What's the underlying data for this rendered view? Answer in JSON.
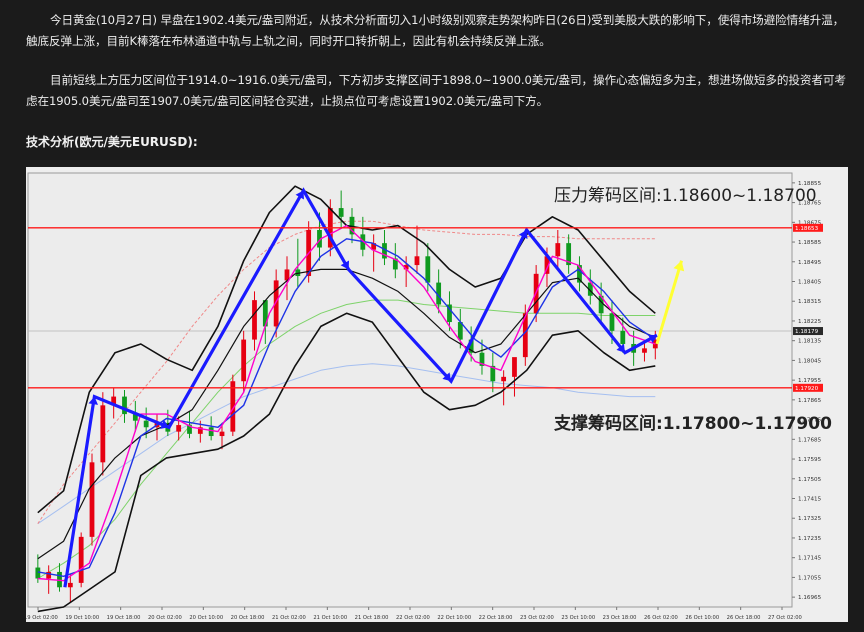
{
  "article": {
    "paragraph1": "今日黄金(10月27日) 早盘在1902.4美元/盎司附近，从技术分析面切入1小时级别观察走势架构昨日(26日)受到美股大跌的影响下，使得市场避险情绪升温，触底反弹上涨，目前K棒落在布林通道中轨与上轨之间，同时开口转折朝上，因此有机会持续反弹上涨。",
    "paragraph2": "目前短线上方压力区间位于1914.0~1916.0美元/盎司，下方初步支撑区间于1898.0~1900.0美元/盎司，操作心态偏短多为主，想进场做短多的投资者可考虑在1905.0美元/盎司至1907.0美元/盎司区间轻仓买进，止损点位可考虑设置1902.0美元/盎司下方。",
    "chart_heading": "技术分析(欧元/美元EURUSD):"
  },
  "chart_data": {
    "type": "line",
    "symbol": "EURUSD",
    "timeframe": "H1",
    "x_labels": [
      "19 Oct 02:00",
      "19 Oct 10:00",
      "19 Oct 18:00",
      "20 Oct 02:00",
      "20 Oct 10:00",
      "20 Oct 18:00",
      "21 Oct 02:00",
      "21 Oct 10:00",
      "21 Oct 18:00",
      "22 Oct 02:00",
      "22 Oct 10:00",
      "22 Oct 18:00",
      "23 Oct 02:00",
      "23 Oct 10:00",
      "23 Oct 18:00",
      "26 Oct 02:00",
      "26 Oct 10:00",
      "26 Oct 18:00",
      "27 Oct 02:00"
    ],
    "y_ticks": [
      "1.18855",
      "1.18765",
      "1.18675",
      "1.18585",
      "1.18495",
      "1.18405",
      "1.18315",
      "1.18225",
      "1.18135",
      "1.18045",
      "1.17955",
      "1.17865",
      "1.17775",
      "1.17685",
      "1.17595",
      "1.17505",
      "1.17415",
      "1.17325",
      "1.17235",
      "1.17145",
      "1.17055",
      "1.16965"
    ],
    "ylim": [
      1.1692,
      1.189
    ],
    "current_price_label": "1.18179",
    "resistance_line_label": "1.18653",
    "support_line_label": "1.17920",
    "resistance_zone_text": "压力筹码区间:1.18600~1.18700",
    "support_zone_text": "支撑筹码区间:1.17800~1.17900",
    "resistance_level": 1.1865,
    "support_level": 1.1792,
    "candles": [
      [
        1.171,
        1.1716,
        1.1703,
        1.1705
      ],
      [
        1.1705,
        1.1711,
        1.1698,
        1.1708
      ],
      [
        1.1708,
        1.1712,
        1.1699,
        1.1701
      ],
      [
        1.1701,
        1.1707,
        1.1694,
        1.1703
      ],
      [
        1.1703,
        1.1726,
        1.1701,
        1.1724
      ],
      [
        1.1724,
        1.1762,
        1.172,
        1.1758
      ],
      [
        1.1758,
        1.179,
        1.1752,
        1.1784
      ],
      [
        1.1784,
        1.1792,
        1.1778,
        1.1788
      ],
      [
        1.1788,
        1.1791,
        1.1776,
        1.178
      ],
      [
        1.178,
        1.1786,
        1.1772,
        1.1777
      ],
      [
        1.1777,
        1.1783,
        1.1769,
        1.1774
      ],
      [
        1.1774,
        1.178,
        1.1768,
        1.1776
      ],
      [
        1.1776,
        1.1782,
        1.177,
        1.1772
      ],
      [
        1.1772,
        1.1779,
        1.1768,
        1.1775
      ],
      [
        1.1775,
        1.1781,
        1.1769,
        1.1771
      ],
      [
        1.1771,
        1.1777,
        1.1767,
        1.1774
      ],
      [
        1.1774,
        1.1779,
        1.1768,
        1.177
      ],
      [
        1.177,
        1.1776,
        1.1764,
        1.1772
      ],
      [
        1.1772,
        1.1798,
        1.177,
        1.1795
      ],
      [
        1.1795,
        1.1818,
        1.179,
        1.1814
      ],
      [
        1.1814,
        1.1836,
        1.1809,
        1.1832
      ],
      [
        1.1832,
        1.1828,
        1.1812,
        1.182
      ],
      [
        1.182,
        1.1846,
        1.1815,
        1.1841
      ],
      [
        1.1841,
        1.1852,
        1.1832,
        1.1846
      ],
      [
        1.1846,
        1.186,
        1.1838,
        1.1843
      ],
      [
        1.1843,
        1.1868,
        1.184,
        1.1864
      ],
      [
        1.1864,
        1.1872,
        1.185,
        1.1856
      ],
      [
        1.1856,
        1.1878,
        1.1852,
        1.1874
      ],
      [
        1.1874,
        1.1882,
        1.1865,
        1.187
      ],
      [
        1.187,
        1.1874,
        1.1858,
        1.1862
      ],
      [
        1.1862,
        1.187,
        1.1852,
        1.1855
      ],
      [
        1.1855,
        1.1862,
        1.1845,
        1.1858
      ],
      [
        1.1858,
        1.1864,
        1.1848,
        1.1851
      ],
      [
        1.1851,
        1.1858,
        1.1842,
        1.1846
      ],
      [
        1.1846,
        1.1852,
        1.1838,
        1.1848
      ],
      [
        1.1848,
        1.1866,
        1.1844,
        1.1852
      ],
      [
        1.1852,
        1.1858,
        1.1836,
        1.184
      ],
      [
        1.184,
        1.1846,
        1.1826,
        1.183
      ],
      [
        1.183,
        1.1836,
        1.1818,
        1.1822
      ],
      [
        1.1822,
        1.1828,
        1.181,
        1.1814
      ],
      [
        1.1814,
        1.182,
        1.1804,
        1.1808
      ],
      [
        1.1808,
        1.1814,
        1.1798,
        1.1802
      ],
      [
        1.1802,
        1.1808,
        1.179,
        1.1795
      ],
      [
        1.1795,
        1.18,
        1.1784,
        1.1797
      ],
      [
        1.1797,
        1.1803,
        1.1788,
        1.1806
      ],
      [
        1.1806,
        1.183,
        1.1802,
        1.1826
      ],
      [
        1.1826,
        1.1848,
        1.1822,
        1.1844
      ],
      [
        1.1844,
        1.1856,
        1.1838,
        1.1852
      ],
      [
        1.1852,
        1.1864,
        1.1846,
        1.1858
      ],
      [
        1.1858,
        1.1862,
        1.1844,
        1.1848
      ],
      [
        1.1848,
        1.1852,
        1.1836,
        1.184
      ],
      [
        1.184,
        1.1846,
        1.183,
        1.1834
      ],
      [
        1.1834,
        1.184,
        1.1822,
        1.1826
      ],
      [
        1.1826,
        1.1832,
        1.1812,
        1.1818
      ],
      [
        1.1818,
        1.1824,
        1.1808,
        1.1812
      ],
      [
        1.1812,
        1.1818,
        1.1802,
        1.1808
      ],
      [
        1.1808,
        1.1814,
        1.1804,
        1.181
      ],
      [
        1.181,
        1.1818,
        1.1805,
        1.1814
      ]
    ],
    "bands": {
      "upper": [
        1.1735,
        1.1745,
        1.179,
        1.1808,
        1.1812,
        1.1805,
        1.18,
        1.182,
        1.185,
        1.1872,
        1.1884,
        1.1878,
        1.1866,
        1.1864,
        1.1866,
        1.1858,
        1.1846,
        1.1838,
        1.1842,
        1.1862,
        1.187,
        1.1864,
        1.185,
        1.1836,
        1.1826
      ],
      "lower": [
        1.169,
        1.1692,
        1.17,
        1.1708,
        1.1752,
        1.176,
        1.1762,
        1.1764,
        1.177,
        1.178,
        1.1802,
        1.182,
        1.1826,
        1.1822,
        1.1806,
        1.179,
        1.1782,
        1.1784,
        1.179,
        1.18,
        1.1816,
        1.1818,
        1.1808,
        1.18,
        1.1802
      ],
      "middle": [
        1.1714,
        1.1722,
        1.1746,
        1.176,
        1.177,
        1.1775,
        1.1782,
        1.18,
        1.182,
        1.1834,
        1.1844,
        1.1846,
        1.1846,
        1.1842,
        1.1836,
        1.1826,
        1.1815,
        1.1808,
        1.1812,
        1.1826,
        1.184,
        1.1842,
        1.183,
        1.182,
        1.1815
      ]
    },
    "ma_fast": [
      1.1705,
      1.1704,
      1.1712,
      1.1744,
      1.178,
      1.178,
      1.1774,
      1.1772,
      1.179,
      1.1826,
      1.1846,
      1.186,
      1.1866,
      1.1855,
      1.185,
      1.1838,
      1.182,
      1.1804,
      1.18,
      1.1826,
      1.1852,
      1.1848,
      1.1832,
      1.1816,
      1.1812
    ],
    "ma_slow": [
      1.1708,
      1.1706,
      1.171,
      1.1735,
      1.177,
      1.1778,
      1.1776,
      1.1774,
      1.1784,
      1.1812,
      1.1836,
      1.1852,
      1.186,
      1.1858,
      1.1852,
      1.1842,
      1.1828,
      1.1814,
      1.1806,
      1.1818,
      1.1838,
      1.1846,
      1.1836,
      1.1822,
      1.1814
    ],
    "ma_long_1": [
      1.1705,
      1.1712,
      1.172,
      1.1732,
      1.1748,
      1.1762,
      1.1776,
      1.179,
      1.1802,
      1.1812,
      1.182,
      1.1826,
      1.183,
      1.1832,
      1.1832,
      1.183,
      1.1829,
      1.1828,
      1.1827,
      1.1826,
      1.1826,
      1.1826,
      1.1825,
      1.1825,
      1.1825
    ],
    "ma_long_2": [
      1.173,
      1.1748,
      1.1762,
      1.1776,
      1.179,
      1.1804,
      1.182,
      1.1834,
      1.1846,
      1.1856,
      1.1862,
      1.1866,
      1.1868,
      1.1868,
      1.1866,
      1.1864,
      1.1863,
      1.1862,
      1.1862,
      1.1861,
      1.1861,
      1.186,
      1.186,
      1.186,
      1.186
    ],
    "ma_long_3": [
      1.173,
      1.1738,
      1.1746,
      1.1754,
      1.1762,
      1.177,
      1.1776,
      1.1782,
      1.1788,
      1.1792,
      1.1796,
      1.18,
      1.1802,
      1.1803,
      1.1802,
      1.18,
      1.1798,
      1.1796,
      1.1794,
      1.1793,
      1.1792,
      1.179,
      1.1789,
      1.1788,
      1.1788
    ],
    "zigzag": [
      [
        0.045,
        1.1701
      ],
      [
        0.081,
        1.1788
      ],
      [
        0.172,
        1.1774
      ],
      [
        0.336,
        1.1882
      ],
      [
        0.391,
        1.1846
      ],
      [
        0.516,
        1.1795
      ],
      [
        0.608,
        1.1864
      ],
      [
        0.728,
        1.1808
      ],
      [
        0.767,
        1.1816
      ]
    ],
    "forecast_arrow": {
      "from": [
        0.767,
        1.1812
      ],
      "to": [
        0.797,
        1.185
      ]
    },
    "colors": {
      "up_candle": "#e60012",
      "down_candle": "#0f9a1f",
      "band": "#111111",
      "ma_fast": "#ff00cc",
      "ma_slow": "#1e33e6",
      "ma_long_1": "#7ed36a",
      "ma_long_2": "#f08888",
      "ma_long_3": "#a5bff0",
      "zigzag": "#1a1aff",
      "arrow": "#ffff33",
      "level_line": "#ff1a1a"
    }
  }
}
